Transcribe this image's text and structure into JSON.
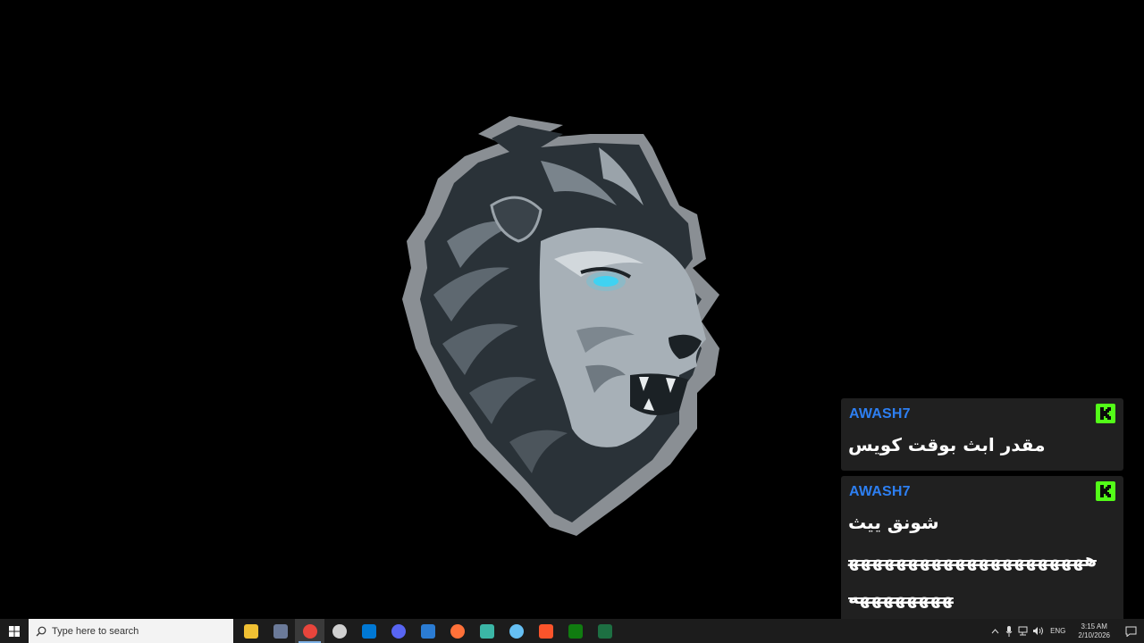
{
  "chat": [
    {
      "username": "AWASH7",
      "badge_icon": "kick-logo-icon",
      "lines": [
        "مقدر ابث بوقت كويس"
      ]
    },
    {
      "username": "AWASH7",
      "badge_icon": "kick-logo-icon",
      "lines": [
        "شونق ييث",
        "هههههههههههههههههههههههههههههه"
      ]
    }
  ],
  "colors": {
    "username": "#2d7ff2",
    "badge": "#53fc18",
    "card_bg": "#202020",
    "taskbar": "#1c1c1c"
  },
  "taskbar": {
    "search_placeholder": "Type here to search",
    "apps": [
      {
        "name": "file-explorer-icon",
        "color": "#f0c033"
      },
      {
        "name": "game-controller-icon",
        "color": "#6b7a99"
      },
      {
        "name": "chrome-icon",
        "color": "#e8453c"
      },
      {
        "name": "obs-icon",
        "color": "#d0d0d0"
      },
      {
        "name": "microsoft-store-icon",
        "color": "#0078d4"
      },
      {
        "name": "discord-icon",
        "color": "#5865f2"
      },
      {
        "name": "word-icon",
        "color": "#2b7cd3"
      },
      {
        "name": "firefox-icon",
        "color": "#ff7139"
      },
      {
        "name": "edge-icon",
        "color": "#3bb6a6"
      },
      {
        "name": "steam-icon",
        "color": "#66c0f4"
      },
      {
        "name": "brave-icon",
        "color": "#fb542b"
      },
      {
        "name": "xbox-icon",
        "color": "#107c10"
      },
      {
        "name": "excel-icon",
        "color": "#1d6f42"
      }
    ],
    "language": "ENG",
    "time": "3:15 AM",
    "date": "2/10/2026"
  }
}
